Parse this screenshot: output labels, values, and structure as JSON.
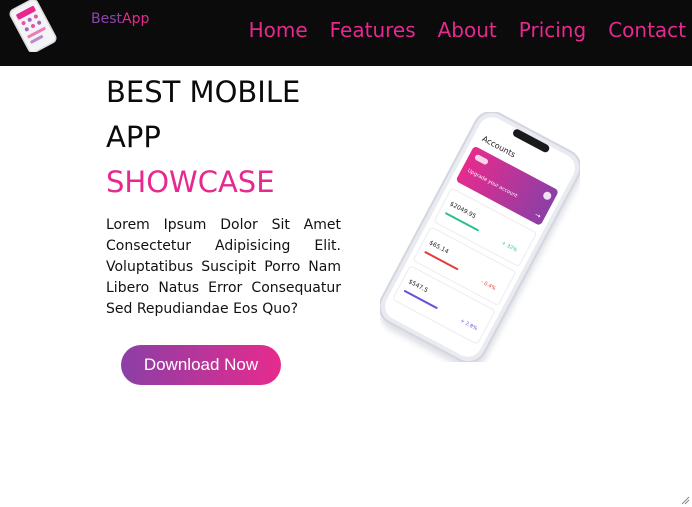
{
  "navbar": {
    "brand_part1": "Best",
    "brand_part2": "App",
    "logo_icon": "phone-logo-icon",
    "links": [
      "Home",
      "Features",
      "About",
      "Pricing",
      "Contact"
    ]
  },
  "hero": {
    "title_line1": "BEST MOBILE APP",
    "title_line2": "SHOWCASE",
    "description": "Lorem Ipsum Dolor Sit Amet Consectetur Adipisicing Elit. Voluptatibus Suscipit Porro Nam Libero Natus Error Consequatur Sed Repudiandae Eos Quo?",
    "button_label": "Download Now"
  },
  "phone_mockup": {
    "screen_title": "Accounts",
    "card_text": "Upgrade your account",
    "rows": [
      {
        "amount": "$2049.95",
        "change": "+ 32%"
      },
      {
        "amount": "$65.14",
        "change": "- 0.4%"
      },
      {
        "amount": "$547.5",
        "change": "+ 2.8%"
      }
    ]
  },
  "colors": {
    "accent": "#e6288f",
    "purple": "#8e44ad",
    "navbar_bg": "#0b0b0b"
  }
}
